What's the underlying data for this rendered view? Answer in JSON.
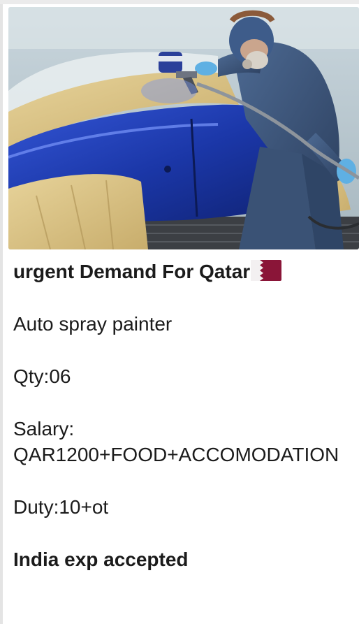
{
  "post": {
    "headline": "urgent Demand For Qatar",
    "headline_flag": "qatar-flag-icon",
    "position": "Auto spray painter",
    "quantity": "Qty:06",
    "salary_label": "Salary:",
    "salary_value": "QAR1200+FOOD+ACCOMODATION",
    "duty": "Duty:10+ot",
    "note": "India exp accepted"
  },
  "colors": {
    "flag_maroon": "#8a1538",
    "car_blue": "#1f3fb0",
    "text": "#1b1b1b"
  }
}
